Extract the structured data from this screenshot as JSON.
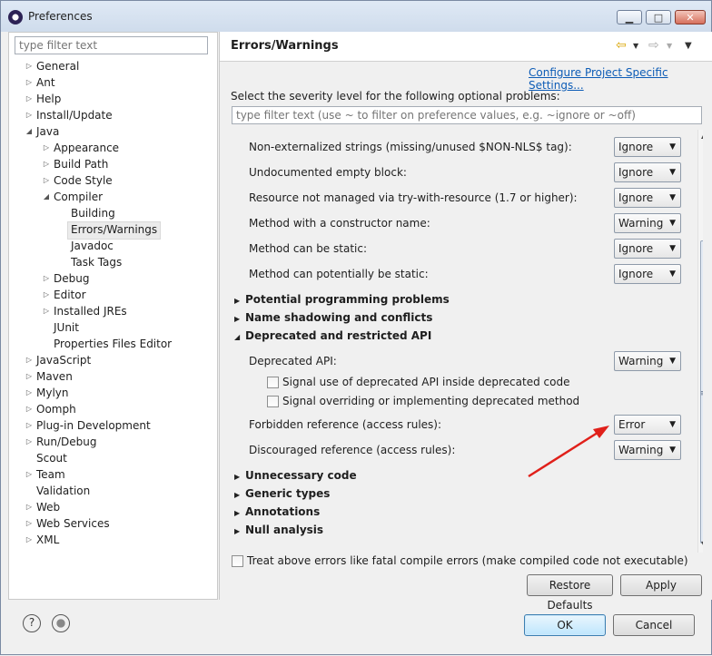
{
  "window": {
    "title": "Preferences",
    "controls": [
      "▁",
      "□",
      "✕"
    ]
  },
  "left_panel": {
    "filter_placeholder": "type filter text",
    "tree": [
      {
        "label": "General",
        "level": 0,
        "expander": "▷"
      },
      {
        "label": "Ant",
        "level": 0,
        "expander": "▷"
      },
      {
        "label": "Help",
        "level": 0,
        "expander": "▷"
      },
      {
        "label": "Install/Update",
        "level": 0,
        "expander": "▷"
      },
      {
        "label": "Java",
        "level": 0,
        "expander": "◢"
      },
      {
        "label": "Appearance",
        "level": 1,
        "expander": "▷"
      },
      {
        "label": "Build Path",
        "level": 1,
        "expander": "▷"
      },
      {
        "label": "Code Style",
        "level": 1,
        "expander": "▷"
      },
      {
        "label": "Compiler",
        "level": 1,
        "expander": "◢"
      },
      {
        "label": "Building",
        "level": 2,
        "expander": ""
      },
      {
        "label": "Errors/Warnings",
        "level": 2,
        "expander": "",
        "selected": true
      },
      {
        "label": "Javadoc",
        "level": 2,
        "expander": ""
      },
      {
        "label": "Task Tags",
        "level": 2,
        "expander": ""
      },
      {
        "label": "Debug",
        "level": 1,
        "expander": "▷"
      },
      {
        "label": "Editor",
        "level": 1,
        "expander": "▷"
      },
      {
        "label": "Installed JREs",
        "level": 1,
        "expander": "▷"
      },
      {
        "label": "JUnit",
        "level": 1,
        "expander": ""
      },
      {
        "label": "Properties Files Editor",
        "level": 1,
        "expander": ""
      },
      {
        "label": "JavaScript",
        "level": 0,
        "expander": "▷"
      },
      {
        "label": "Maven",
        "level": 0,
        "expander": "▷"
      },
      {
        "label": "Mylyn",
        "level": 0,
        "expander": "▷"
      },
      {
        "label": "Oomph",
        "level": 0,
        "expander": "▷"
      },
      {
        "label": "Plug-in Development",
        "level": 0,
        "expander": "▷"
      },
      {
        "label": "Run/Debug",
        "level": 0,
        "expander": "▷"
      },
      {
        "label": "Scout",
        "level": 0,
        "expander": ""
      },
      {
        "label": "Team",
        "level": 0,
        "expander": "▷"
      },
      {
        "label": "Validation",
        "level": 0,
        "expander": ""
      },
      {
        "label": "Web",
        "level": 0,
        "expander": "▷"
      },
      {
        "label": "Web Services",
        "level": 0,
        "expander": "▷"
      },
      {
        "label": "XML",
        "level": 0,
        "expander": "▷"
      }
    ]
  },
  "right_panel": {
    "title": "Errors/Warnings",
    "nav_icons": [
      "back-arrow-icon",
      "forward-arrow-icon",
      "view-menu-icon"
    ],
    "configure_link": "Configure Project Specific Settings...",
    "severity_label": "Select the severity level for the following optional problems:",
    "filter_placeholder": "type filter text (use ~ to filter on preference values, e.g. ~ignore or ~off)",
    "options_top": [
      {
        "label": "Non-externalized strings (missing/unused $NON-NLS$ tag):",
        "value": "Ignore"
      },
      {
        "label": "Undocumented empty block:",
        "value": "Ignore"
      },
      {
        "label": "Resource not managed via try-with-resource (1.7 or higher):",
        "value": "Ignore"
      },
      {
        "label": "Method with a constructor name:",
        "value": "Warning"
      },
      {
        "label": "Method can be static:",
        "value": "Ignore"
      },
      {
        "label": "Method can potentially be static:",
        "value": "Ignore"
      }
    ],
    "sections_a": [
      {
        "label": "Potential programming problems",
        "expander": "▶"
      },
      {
        "label": "Name shadowing and conflicts",
        "expander": "▶"
      },
      {
        "label": "Deprecated and restricted API",
        "expander": "◢"
      }
    ],
    "deprecated": {
      "api_label": "Deprecated API:",
      "api_value": "Warning",
      "check1": "Signal use of deprecated API inside deprecated code",
      "check2": "Signal overriding or implementing deprecated method",
      "forbidden_label": "Forbidden reference (access rules):",
      "forbidden_value": "Error",
      "discouraged_label": "Discouraged reference (access rules):",
      "discouraged_value": "Warning"
    },
    "sections_b": [
      {
        "label": "Unnecessary code",
        "expander": "▶"
      },
      {
        "label": "Generic types",
        "expander": "▶"
      },
      {
        "label": "Annotations",
        "expander": "▶"
      },
      {
        "label": "Null analysis",
        "expander": "▶"
      }
    ],
    "treat_errors_label": "Treat above errors like fatal compile errors (make compiled code not executable)",
    "restore_defaults": "Restore Defaults",
    "apply": "Apply"
  },
  "footer": {
    "help_icon": "?",
    "ok": "OK",
    "cancel": "Cancel"
  },
  "colors": {
    "link": "#0d5cb6",
    "annotation_arrow": "#e0201a"
  }
}
